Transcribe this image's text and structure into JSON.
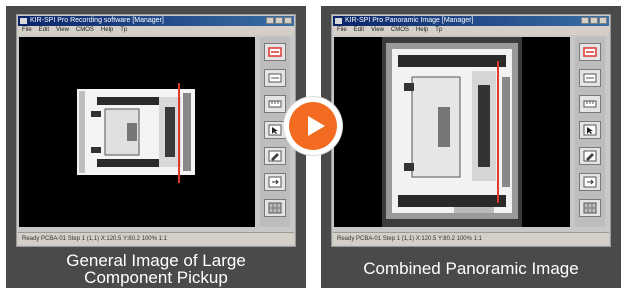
{
  "panels": [
    {
      "window": {
        "title": "KIR-SPI Pro  Recording software  [Manager]",
        "menu": [
          "File",
          "Edit",
          "View",
          "CMOS",
          "Help",
          "Tp"
        ],
        "status": "Ready  PCBA-01  Step 1 (1,1)  X:120.5  Y:80.2      100%  1:1",
        "toolbar_icons": [
          "red-marker-icon",
          "zoom-icon",
          "measure-icon",
          "cursor-icon",
          "edit-icon",
          "export-icon",
          "grid-icon"
        ]
      },
      "caption_lines": [
        "General Image of Large",
        "Component Pickup"
      ]
    },
    {
      "window": {
        "title": "KIR-SPI Pro  Panoramic Image  [Manager]",
        "menu": [
          "File",
          "Edit",
          "View",
          "CMOS",
          "Help",
          "Tp"
        ],
        "status": "Ready  PCBA-01  Step 1 (1,1)  X:120.5  Y:80.2      100%  1:1",
        "toolbar_icons": [
          "red-marker-icon",
          "zoom-icon",
          "measure-icon",
          "cursor-icon",
          "edit-icon",
          "export-icon",
          "grid-icon"
        ]
      },
      "caption_lines": [
        "Combined Panoramic Image"
      ]
    }
  ],
  "arrow": {
    "icon": "play-arrow-icon",
    "color": "#f26b21"
  }
}
